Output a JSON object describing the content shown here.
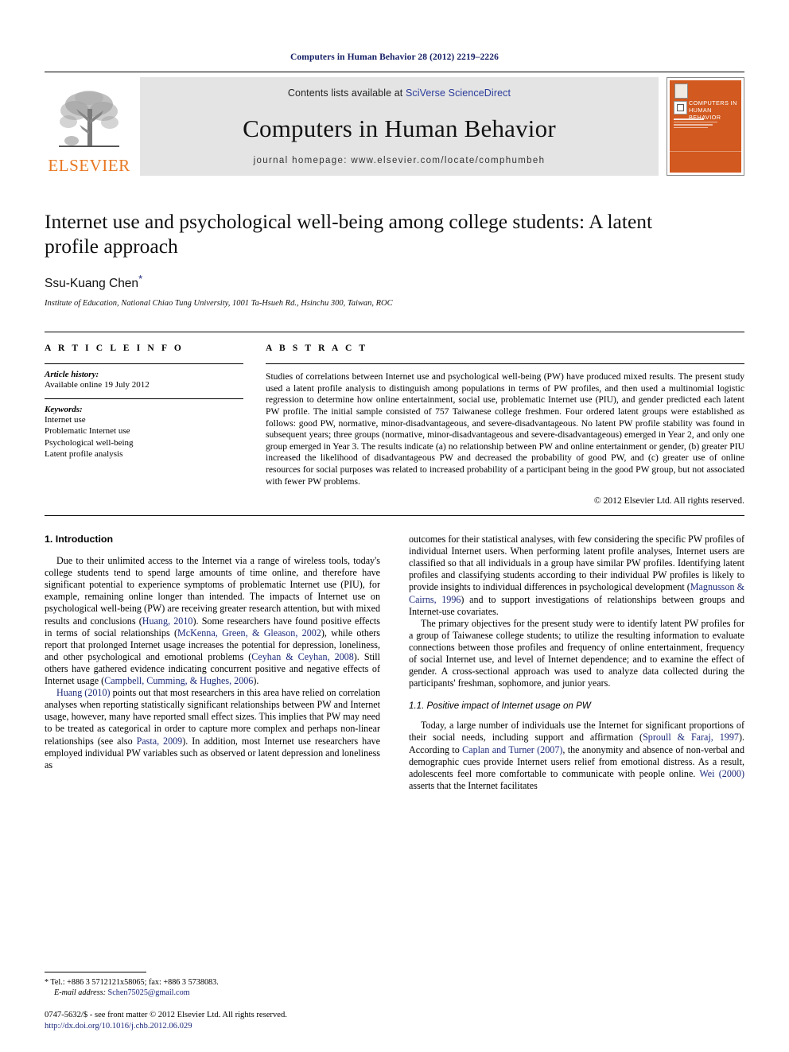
{
  "running_head": "Computers in Human Behavior 28 (2012) 2219–2226",
  "masthead": {
    "publisher_name": "ELSEVIER",
    "contents_prefix": "Contents lists available at ",
    "contents_link": "SciVerse ScienceDirect",
    "journal_title": "Computers in Human Behavior",
    "homepage_line": "journal homepage: www.elsevier.com/locate/comphumbeh",
    "cover_title": "COMPUTERS IN HUMAN BEHAVIOR",
    "cover_color": "#d2591f",
    "band_color": "#e4e4e4",
    "link_color": "#2a3b9b"
  },
  "article": {
    "title": "Internet use and psychological well-being among college students: A latent profile approach",
    "author": "Ssu-Kuang Chen",
    "author_marker": "*",
    "affiliation": "Institute of Education, National Chiao Tung University, 1001 Ta-Hsueh Rd., Hsinchu 300, Taiwan, ROC"
  },
  "article_info": {
    "heading": "A R T I C L E   I N F O",
    "history_label": "Article history:",
    "history_value": "Available online 19 July 2012",
    "keywords_label": "Keywords:",
    "keywords": [
      "Internet use",
      "Problematic Internet use",
      "Psychological well-being",
      "Latent profile analysis"
    ]
  },
  "abstract": {
    "heading": "A B S T R A C T",
    "text": "Studies of correlations between Internet use and psychological well-being (PW) have produced mixed results. The present study used a latent profile analysis to distinguish among populations in terms of PW profiles, and then used a multinomial logistic regression to determine how online entertainment, social use, problematic Internet use (PIU), and gender predicted each latent PW profile. The initial sample consisted of 757 Taiwanese college freshmen. Four ordered latent groups were established as follows: good PW, normative, minor-disadvantageous, and severe-disadvantageous. No latent PW profile stability was found in subsequent years; three groups (normative, minor-disadvantageous and severe-disadvantageous) emerged in Year 2, and only one group emerged in Year 3. The results indicate (a) no relationship between PW and online entertainment or gender, (b) greater PIU increased the likelihood of disadvantageous PW and decreased the probability of good PW, and (c) greater use of online resources for social purposes was related to increased probability of a participant being in the good PW group, but not associated with fewer PW problems.",
    "copyright": "© 2012 Elsevier Ltd. All rights reserved."
  },
  "body": {
    "intro_heading": "1. Introduction",
    "left_p1_a": "Due to their unlimited access to the Internet via a range of wireless tools, today's college students tend to spend large amounts of time online, and therefore have significant potential to experience symptoms of problematic Internet use (PIU), for example, remaining online longer than intended. The impacts of Internet use on psychological well-being (PW) are receiving greater research attention, but with mixed results and conclusions (",
    "left_p1_ref1": "Huang, 2010",
    "left_p1_b": "). Some researchers have found positive effects in terms of social relationships (",
    "left_p1_ref2": "McKenna, Green, & Gleason, 2002",
    "left_p1_c": "), while others report that prolonged Internet usage increases the potential for depression, loneliness, and other psychological and emotional problems (",
    "left_p1_ref3": "Ceyhan & Ceyhan, 2008",
    "left_p1_d": "). Still others have gathered evidence indicating concurrent positive and negative effects of Internet usage (",
    "left_p1_ref4": "Campbell, Cumming, & Hughes, 2006",
    "left_p1_e": ").",
    "left_p2_ref1": "Huang (2010)",
    "left_p2_a": " points out that most researchers in this area have relied on correlation analyses when reporting statistically significant relationships between PW and Internet usage, however, many have reported small effect sizes. This implies that PW may need to be treated as categorical in order to capture more complex and perhaps non-linear relationships (see also ",
    "left_p2_ref2": "Pasta, 2009",
    "left_p2_b": "). In addition, most Internet use researchers have employed individual PW variables such as observed or latent depression and loneliness as",
    "right_p1_a": "outcomes for their statistical analyses, with few considering the specific PW profiles of individual Internet users. When performing latent profile analyses, Internet users are classified so that all individuals in a group have similar PW profiles. Identifying latent profiles and classifying students according to their individual PW profiles is likely to provide insights to individual differences in psychological development (",
    "right_p1_ref1": "Magnusson & Cairns, 1996",
    "right_p1_b": ") and to support investigations of relationships between groups and Internet-use covariates.",
    "right_p2": "The primary objectives for the present study were to identify latent PW profiles for a group of Taiwanese college students; to utilize the resulting information to evaluate connections between those profiles and frequency of online entertainment, frequency of social Internet use, and level of Internet dependence; and to examine the effect of gender. A cross-sectional approach was used to analyze data collected during the participants' freshman, sophomore, and junior years.",
    "sub_heading_1_1": "1.1. Positive impact of Internet usage on PW",
    "right_p3_a": "Today, a large number of individuals use the Internet for significant proportions of their social needs, including support and affirmation (",
    "right_p3_ref1": "Sproull & Faraj, 1997",
    "right_p3_b": "). According to ",
    "right_p3_ref2": "Caplan and Turner (2007)",
    "right_p3_c": ", the anonymity and absence of non-verbal and demographic cues provide Internet users relief from emotional distress. As a result, adolescents feel more comfortable to communicate with people online. ",
    "right_p3_ref3": "Wei (2000)",
    "right_p3_d": " asserts that the Internet facilitates"
  },
  "footnotes": {
    "corresponding_marker": "*",
    "tel_line": "Tel.: +886 3 5712121x58065; fax: +886 3 5738083.",
    "email_label": "E-mail address:",
    "email": "Schen75025@gmail.com",
    "issn_line": "0747-5632/$ - see front matter © 2012 Elsevier Ltd. All rights reserved.",
    "doi": "http://dx.doi.org/10.1016/j.chb.2012.06.029"
  }
}
